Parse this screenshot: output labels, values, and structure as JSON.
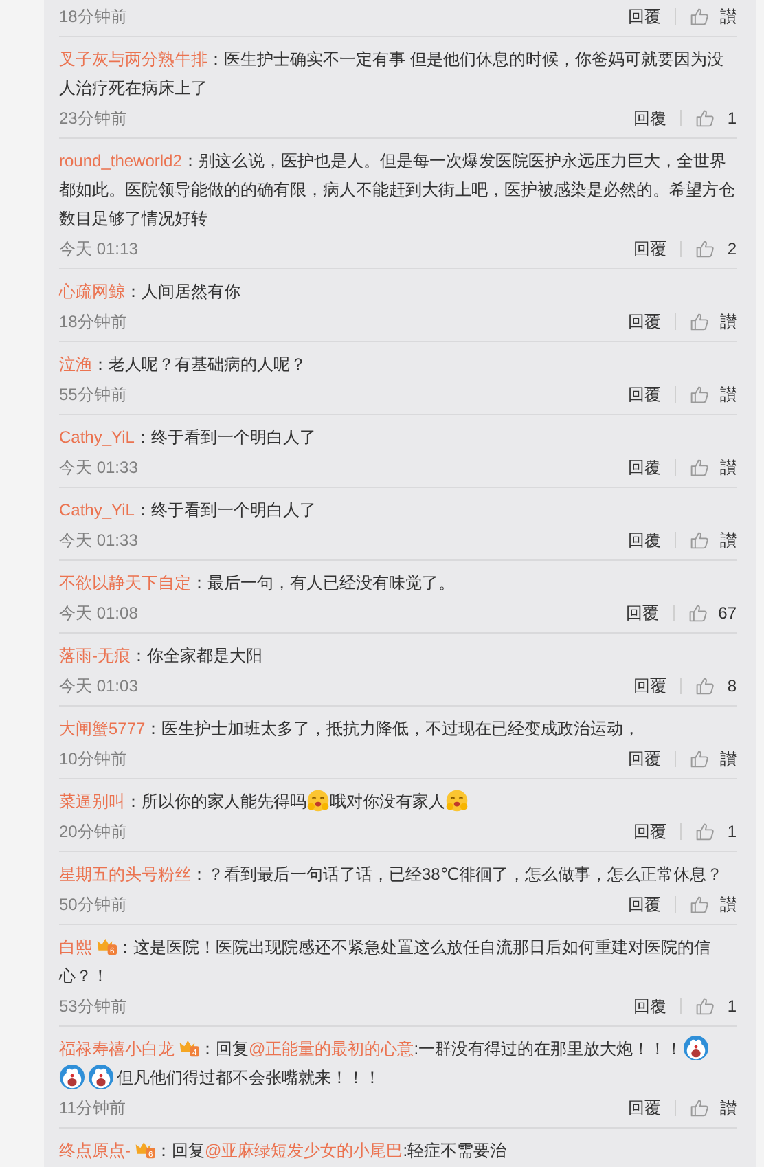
{
  "comments": [
    {
      "time": "18分钟前",
      "reply": "回覆",
      "likes": "讃"
    },
    {
      "author": "叉子灰与两分熟牛排",
      "body": [
        {
          "kind": "text",
          "text": "：医生护士确实不一定有事 但是他们休息的时候，你爸妈可就要因为没人治疗死在病床上了"
        }
      ],
      "time": "23分钟前",
      "reply": "回覆",
      "likes": "1"
    },
    {
      "author": "round_theworld2",
      "body": [
        {
          "kind": "text",
          "text": "：别这么说，医护也是人。但是每一次爆发医院医护永远压力巨大，全世界都如此。医院领导能做的的确有限，病人不能赶到大街上吧，医护被感染是必然的。希望方仓数目足够了情况好转"
        }
      ],
      "time": "今天 01:13",
      "reply": "回覆",
      "likes": "2"
    },
    {
      "author": "心疏网鲸",
      "body": [
        {
          "kind": "text",
          "text": "：人间居然有你"
        }
      ],
      "time": "18分钟前",
      "reply": "回覆",
      "likes": "讃"
    },
    {
      "author": "泣渔",
      "body": [
        {
          "kind": "text",
          "text": "：老人呢？有基础病的人呢？"
        }
      ],
      "time": "55分钟前",
      "reply": "回覆",
      "likes": "讃"
    },
    {
      "author": "Cathy_YiL",
      "body": [
        {
          "kind": "text",
          "text": "：终于看到一个明白人了"
        }
      ],
      "time": "今天 01:33",
      "reply": "回覆",
      "likes": "讃"
    },
    {
      "author": "Cathy_YiL",
      "body": [
        {
          "kind": "text",
          "text": "：终于看到一个明白人了"
        }
      ],
      "time": "今天 01:33",
      "reply": "回覆",
      "likes": "讃"
    },
    {
      "author": "不欲以静天下自定",
      "body": [
        {
          "kind": "text",
          "text": "：最后一句，有人已经没有味觉了。"
        }
      ],
      "time": "今天 01:08",
      "reply": "回覆",
      "likes": "67"
    },
    {
      "author": "落雨-无痕",
      "body": [
        {
          "kind": "text",
          "text": "：你全家都是大阳"
        }
      ],
      "time": "今天 01:03",
      "reply": "回覆",
      "likes": "8"
    },
    {
      "author": "大闸蟹5777",
      "body": [
        {
          "kind": "text",
          "text": "：医生护士加班太多了，抵抗力降低，不过现在已经变成政治运动，"
        }
      ],
      "time": "10分钟前",
      "reply": "回覆",
      "likes": "讃"
    },
    {
      "author": "菜逼别叫",
      "body": [
        {
          "kind": "text",
          "text": "：所以你的家人能先得吗"
        },
        {
          "kind": "smiley"
        },
        {
          "kind": "text",
          "text": "哦对你没有家人"
        },
        {
          "kind": "smiley"
        }
      ],
      "time": "20分钟前",
      "reply": "回覆",
      "likes": "1"
    },
    {
      "author": "星期五的头号粉丝",
      "body": [
        {
          "kind": "text",
          "text": "：？看到最后一句话了话，已经38℃徘徊了，怎么做事，怎么正常休息？"
        }
      ],
      "time": "50分钟前",
      "reply": "回覆",
      "likes": "讃"
    },
    {
      "author": "白熙",
      "badge": "6",
      "body": [
        {
          "kind": "text",
          "text": "：这是医院！医院出现院感还不紧急处置这么放任自流那日后如何重建对医院的信心？！"
        }
      ],
      "time": "53分钟前",
      "reply": "回覆",
      "likes": "1"
    },
    {
      "author": "福禄寿禧小白龙",
      "badge": "4",
      "body": [
        {
          "kind": "text",
          "text": "：回复"
        },
        {
          "kind": "mention",
          "text": "@正能量的最初的心意"
        },
        {
          "kind": "text",
          "text": ":一群没有得过的在那里放大炮！！！"
        },
        {
          "kind": "mascot"
        },
        {
          "kind": "mascot"
        },
        {
          "kind": "mascot"
        },
        {
          "kind": "text",
          "text": "但凡他们得过都不会张嘴就来！！！"
        }
      ],
      "time": "11分钟前",
      "reply": "回覆",
      "likes": "讃"
    },
    {
      "author": "终点原点-",
      "badge": "6",
      "body": [
        {
          "kind": "text",
          "text": "：回复"
        },
        {
          "kind": "mention",
          "text": "@亚麻绿短发少女的小尾巴"
        },
        {
          "kind": "text",
          "text": ":轻症不需要治"
        }
      ]
    }
  ]
}
